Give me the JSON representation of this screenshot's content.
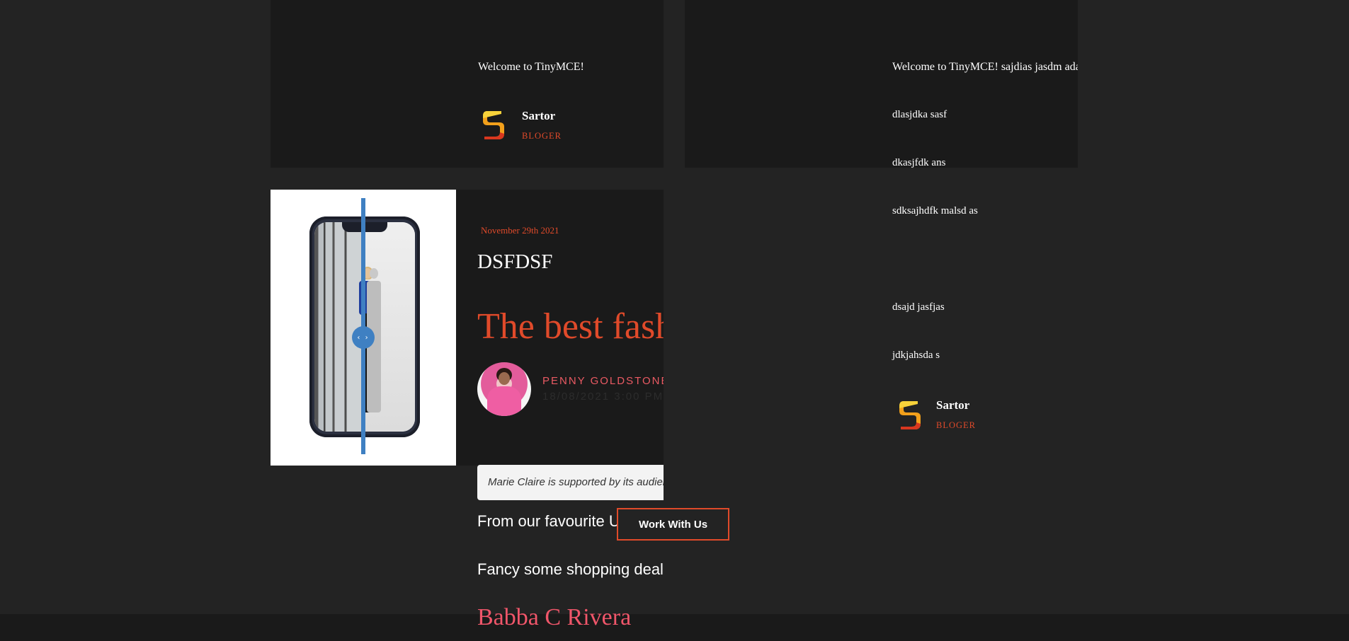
{
  "top_left_card": {
    "welcome": "Welcome to TinyMCE!",
    "author": {
      "name": "Sartor",
      "role": "BLOGER",
      "logo_icon": "s-logo-icon"
    }
  },
  "top_right_card": {
    "welcome": "Welcome to TinyMCE! sajdias jasdm ada",
    "lines": [
      "dlasjdka sasf",
      "dkasjfdk ans",
      "sdksajhdfk malsd as",
      "dsajd jasfjas",
      "jdkjahsda s"
    ],
    "author": {
      "name": "Sartor",
      "role": "BLOGER",
      "logo_icon": "s-logo-icon"
    }
  },
  "article": {
    "date": "November 29th 2021",
    "title": "DSFDSF",
    "headline": "The best fashion",
    "author_name": "PENNY GOLDSTONE",
    "author_date": "18/08/2021 3:00 PM",
    "compare_handle_glyph": "‹ ›"
  },
  "quote": "Marie Claire is supported by its audience",
  "paragraphs": [
    "From our favourite UK",
    "Fancy some shopping deals"
  ],
  "byline_big": "Babba C Rivera",
  "buttons": {
    "work_with_us": "Work With Us"
  },
  "colors": {
    "accent": "#e04a2a",
    "pink": "#f0566a",
    "card_bg": "#1a1a1a",
    "page_bg": "#232323",
    "slider": "#3f80c2"
  }
}
